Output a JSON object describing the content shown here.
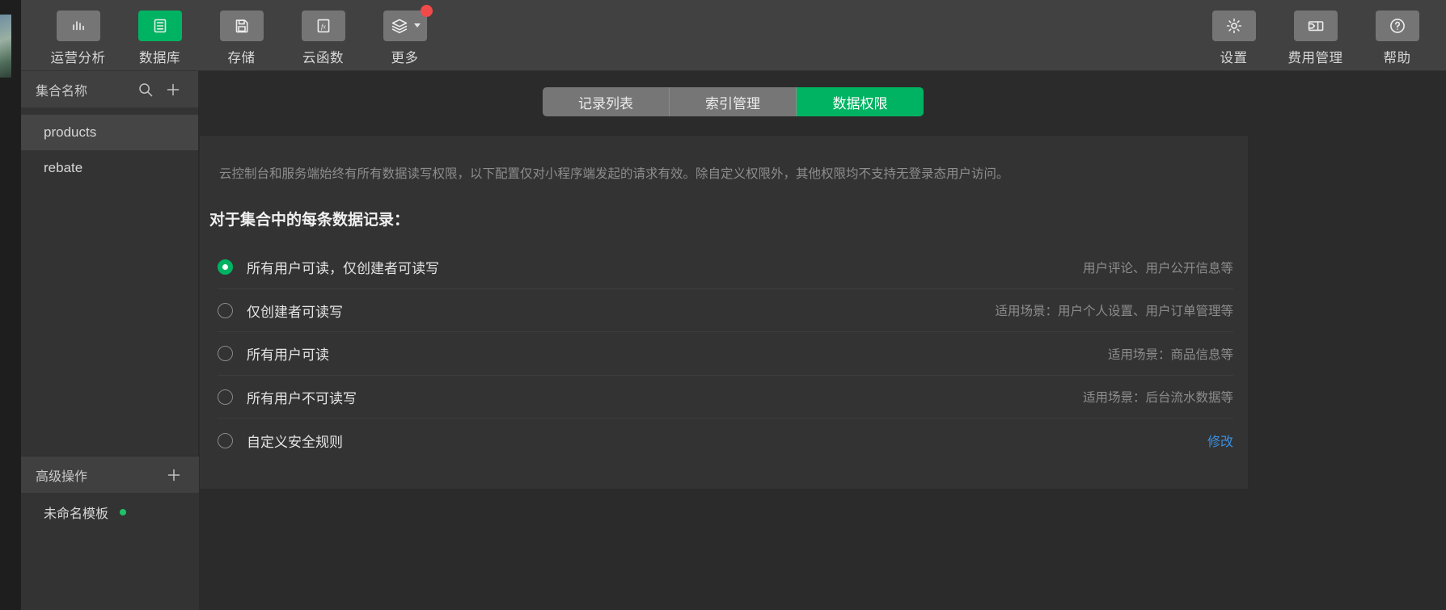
{
  "toolbar": {
    "left_items": [
      {
        "label": "运营分析",
        "icon": "bar-chart-icon",
        "active": false,
        "badge": false,
        "caret": false
      },
      {
        "label": "数据库",
        "icon": "database-icon",
        "active": true,
        "badge": false,
        "caret": false
      },
      {
        "label": "存储",
        "icon": "save-disk-icon",
        "active": false,
        "badge": false,
        "caret": false
      },
      {
        "label": "云函数",
        "icon": "fx-function-icon",
        "active": false,
        "badge": false,
        "caret": false
      },
      {
        "label": "更多",
        "icon": "layers-icon",
        "active": false,
        "badge": true,
        "caret": true
      }
    ],
    "right_items": [
      {
        "label": "设置",
        "icon": "gear-icon"
      },
      {
        "label": "费用管理",
        "icon": "billing-panel-icon"
      },
      {
        "label": "帮助",
        "icon": "question-circle-icon"
      }
    ]
  },
  "sidebar": {
    "header_title": "集合名称",
    "search_icon": "search-icon",
    "add_icon": "plus-icon",
    "collections": [
      {
        "name": "products",
        "selected": true
      },
      {
        "name": "rebate",
        "selected": false
      }
    ],
    "advanced": {
      "title": "高级操作",
      "add_icon": "plus-icon",
      "templates": [
        {
          "name": "未命名模板",
          "status_dot": "#1fc26a"
        }
      ]
    }
  },
  "main": {
    "tabs": [
      {
        "label": "记录列表",
        "active": false
      },
      {
        "label": "索引管理",
        "active": false
      },
      {
        "label": "数据权限",
        "active": true
      }
    ],
    "note": "云控制台和服务端始终有所有数据读写权限，以下配置仅对小程序端发起的请求有效。除自定义权限外，其他权限均不支持无登录态用户访问。",
    "heading": "对于集合中的每条数据记录：",
    "options": [
      {
        "label": "所有用户可读，仅创建者可读写",
        "hint": "用户评论、用户公开信息等",
        "selected": true,
        "link": ""
      },
      {
        "label": "仅创建者可读写",
        "hint": "适用场景：用户个人设置、用户订单管理等",
        "selected": false,
        "link": ""
      },
      {
        "label": "所有用户可读",
        "hint": "适用场景：商品信息等",
        "selected": false,
        "link": ""
      },
      {
        "label": "所有用户不可读写",
        "hint": "适用场景：后台流水数据等",
        "selected": false,
        "link": ""
      },
      {
        "label": "自定义安全规则",
        "hint": "",
        "selected": false,
        "link": "修改"
      }
    ]
  },
  "colors": {
    "accent_green": "#00b362",
    "link_blue": "#3a8fe0",
    "badge_red": "#f04a4a",
    "status_dot_green": "#1fc26a"
  }
}
